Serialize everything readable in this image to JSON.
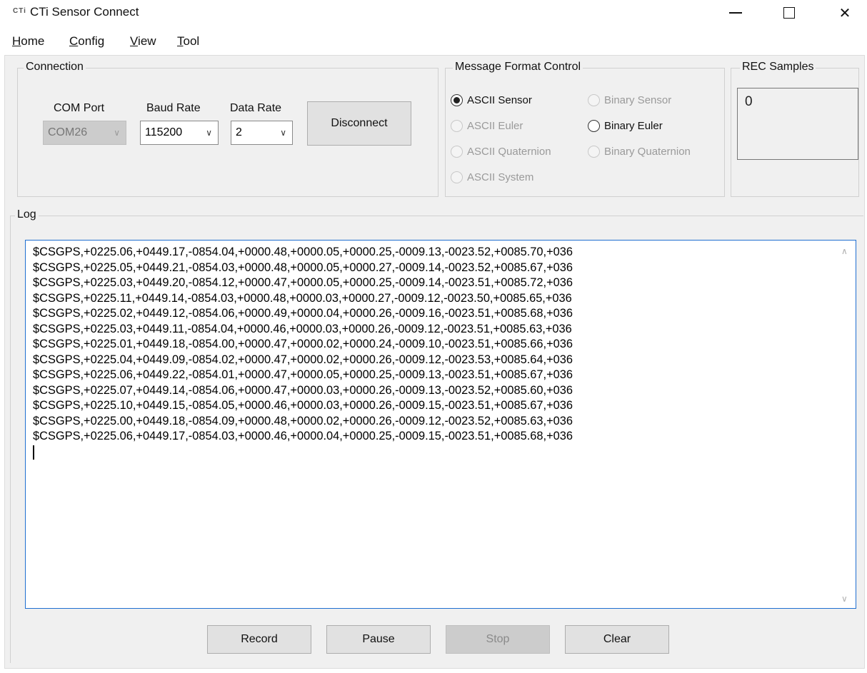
{
  "window": {
    "logo": "CTi",
    "title": "CTi Sensor Connect",
    "min_glyph": "—",
    "close_glyph": "✕"
  },
  "menu": {
    "items": [
      {
        "u": "H",
        "rest": "ome"
      },
      {
        "u": "C",
        "rest": "onfig"
      },
      {
        "u": "V",
        "rest": "iew"
      },
      {
        "u": "T",
        "rest": "ool"
      }
    ]
  },
  "connection": {
    "legend": "Connection",
    "com_port_label": "COM Port",
    "com_port_value": "COM26",
    "baud_rate_label": "Baud Rate",
    "baud_rate_value": "115200",
    "data_rate_label": "Data Rate",
    "data_rate_value": "2",
    "disconnect_label": "Disconnect",
    "arrow_glyph": "∨"
  },
  "message_format": {
    "legend": "Message Format Control",
    "options": [
      {
        "label": "ASCII Sensor",
        "selected": true,
        "enabled": true
      },
      {
        "label": "Binary Sensor",
        "selected": false,
        "enabled": false
      },
      {
        "label": "ASCII Euler",
        "selected": false,
        "enabled": false
      },
      {
        "label": "Binary Euler",
        "selected": false,
        "enabled": true
      },
      {
        "label": "ASCII Quaternion",
        "selected": false,
        "enabled": false
      },
      {
        "label": "Binary Quaternion",
        "selected": false,
        "enabled": false
      },
      {
        "label": "ASCII System",
        "selected": false,
        "enabled": false
      }
    ]
  },
  "rec_samples": {
    "legend": "REC Samples",
    "value": "0"
  },
  "log": {
    "legend": "Log",
    "lines": [
      "$CSGPS,+0225.06,+0449.17,-0854.04,+0000.48,+0000.05,+0000.25,-0009.13,-0023.52,+0085.70,+036",
      "$CSGPS,+0225.05,+0449.21,-0854.03,+0000.48,+0000.05,+0000.27,-0009.14,-0023.52,+0085.67,+036",
      "$CSGPS,+0225.03,+0449.20,-0854.12,+0000.47,+0000.05,+0000.25,-0009.14,-0023.51,+0085.72,+036",
      "$CSGPS,+0225.11,+0449.14,-0854.03,+0000.48,+0000.03,+0000.27,-0009.12,-0023.50,+0085.65,+036",
      "$CSGPS,+0225.02,+0449.12,-0854.06,+0000.49,+0000.04,+0000.26,-0009.16,-0023.51,+0085.68,+036",
      "$CSGPS,+0225.03,+0449.11,-0854.04,+0000.46,+0000.03,+0000.26,-0009.12,-0023.51,+0085.63,+036",
      "$CSGPS,+0225.01,+0449.18,-0854.00,+0000.47,+0000.02,+0000.24,-0009.10,-0023.51,+0085.66,+036",
      "$CSGPS,+0225.04,+0449.09,-0854.02,+0000.47,+0000.02,+0000.26,-0009.12,-0023.53,+0085.64,+036",
      "$CSGPS,+0225.06,+0449.22,-0854.01,+0000.47,+0000.05,+0000.25,-0009.13,-0023.51,+0085.67,+036",
      "$CSGPS,+0225.07,+0449.14,-0854.06,+0000.47,+0000.03,+0000.26,-0009.13,-0023.52,+0085.60,+036",
      "$CSGPS,+0225.10,+0449.15,-0854.05,+0000.46,+0000.03,+0000.26,-0009.15,-0023.51,+0085.67,+036",
      "$CSGPS,+0225.00,+0449.18,-0854.09,+0000.48,+0000.02,+0000.26,-0009.12,-0023.52,+0085.63,+036",
      "$CSGPS,+0225.06,+0449.17,-0854.03,+0000.46,+0000.04,+0000.25,-0009.15,-0023.51,+0085.68,+036"
    ],
    "scroll_up_glyph": "∧",
    "scroll_down_glyph": "∨"
  },
  "buttons": {
    "record": "Record",
    "pause": "Pause",
    "stop": "Stop",
    "clear": "Clear"
  }
}
